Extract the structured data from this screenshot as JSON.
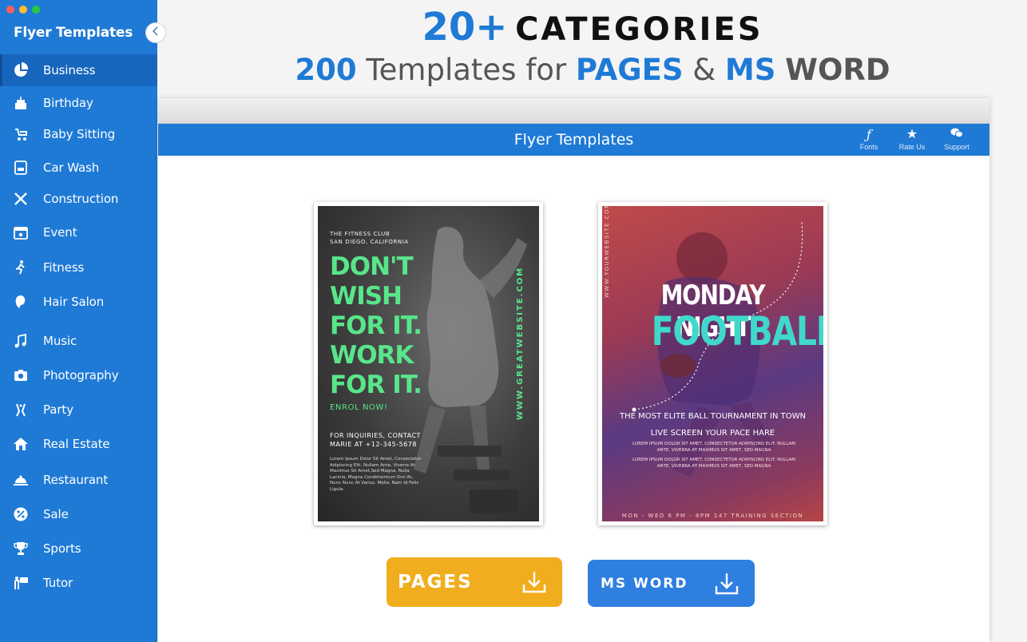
{
  "sidebar": {
    "title": "Flyer Templates",
    "items": [
      {
        "label": "Business",
        "icon": "pie-chart-icon"
      },
      {
        "label": "Birthday",
        "icon": "cake-icon"
      },
      {
        "label": "Baby Sitting",
        "icon": "stroller-icon"
      },
      {
        "label": "Car Wash",
        "icon": "car-wash-icon"
      },
      {
        "label": "Construction",
        "icon": "tools-icon"
      },
      {
        "label": "Event",
        "icon": "calendar-icon"
      },
      {
        "label": "Fitness",
        "icon": "runner-icon"
      },
      {
        "label": "Hair Salon",
        "icon": "hair-icon"
      },
      {
        "label": "Music",
        "icon": "music-note-icon"
      },
      {
        "label": "Photography",
        "icon": "camera-icon"
      },
      {
        "label": "Party",
        "icon": "party-icon"
      },
      {
        "label": "Real Estate",
        "icon": "house-icon"
      },
      {
        "label": "Restaurant",
        "icon": "cloche-icon"
      },
      {
        "label": "Sale",
        "icon": "percent-badge-icon"
      },
      {
        "label": "Sports",
        "icon": "trophy-icon"
      },
      {
        "label": "Tutor",
        "icon": "teacher-icon"
      }
    ]
  },
  "banner": {
    "count": "20+",
    "categories": "CATEGORIES",
    "templates_count": "200",
    "templates_text": "Templates for",
    "pages": "PAGES",
    "amp": "&",
    "ms": "MS",
    "word": "WORD"
  },
  "window": {
    "title": "Flyer Templates",
    "actions": [
      {
        "label": "Fonts",
        "icon": "font-icon"
      },
      {
        "label": "Rate Us",
        "icon": "star-icon"
      },
      {
        "label": "Support",
        "icon": "chat-bubbles-icon"
      }
    ]
  },
  "flyers": {
    "fitness": {
      "club": "THE FITNESS CLUB",
      "location": "SAN DIEGO, CALIFORNIA",
      "headline": [
        "DON'T",
        "WISH",
        "FOR IT.",
        "WORK",
        "FOR IT."
      ],
      "enrol": "ENROL NOW!",
      "inquiry": "FOR INQUIRIES, CONTACT MARIE AT +12-345-5678",
      "lorem": "Lorem Ipsum Dolor Sit Amet, Consectetur Adipiscing Elit. Nullam Ante, Viverra At Maximus Sit Amet,Sed Magna. Nulla Lacinia, Magna Condimentum Orci Ac, Nunc Nunc At Varius. Mella. Nam Id Felis Ligula.",
      "website": "WWW.GREATWEBSITE.COM"
    },
    "football": {
      "website": "WWW.YOURWEBSITE.COM",
      "line1": "MONDAY NIGHT",
      "line2": "FOOTBALL",
      "tag1": "THE MOST ELITE BALL TOURNAMENT IN TOWN",
      "tag2": "LIVE SCREEN YOUR PACE HARE",
      "lorem1": "LOREM IPSUM DOLOR SIT AMET, CONSECTETUR ADIPISCING ELIT. NULLAM ANTE, VIVERRA AT MAXIMUS SIT AMET, SED MAGNA",
      "lorem2": "LOREM IPSUM DOLOR SIT AMET, CONSECTETUR ADIPISCING ELIT. NULLAM ANTE, VIVERRA AT MAXIMUS SIT AMET, SED MAGNA",
      "bottom": "MON - WED 6 PM - 8PM 147 TRAINING SECTION"
    }
  },
  "downloads": {
    "pages": "PAGES",
    "word": "MS WORD"
  },
  "colors": {
    "accent": "#1f7ad6",
    "pages_button": "#f0ad1e",
    "word_button": "#2e7fe0",
    "fitness_green": "#58e68a",
    "football_teal": "#3fd9cb"
  }
}
